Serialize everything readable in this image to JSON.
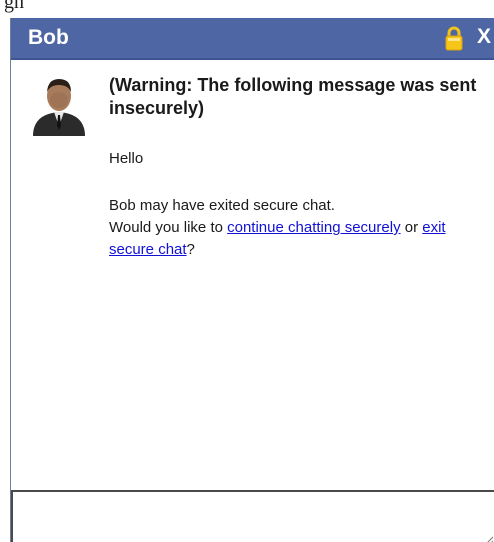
{
  "caption": {
    "text": "gh"
  },
  "window": {
    "title": "Bob",
    "close_label": "X",
    "lock_icon": "lock-icon",
    "close_icon": "close-icon",
    "title_bar_color": "#4e67a4"
  },
  "message": {
    "warning": "(Warning: The following message was sent insecurely)",
    "body": "Hello"
  },
  "notice": {
    "line1": "Bob may have exited secure chat.",
    "line2_prefix": "Would you like to ",
    "continue_link": "continue chatting securely",
    "middle": " or ",
    "exit_link": "exit secure chat",
    "suffix": "?",
    "link_color": "#1212d6"
  },
  "input": {
    "value": ""
  }
}
